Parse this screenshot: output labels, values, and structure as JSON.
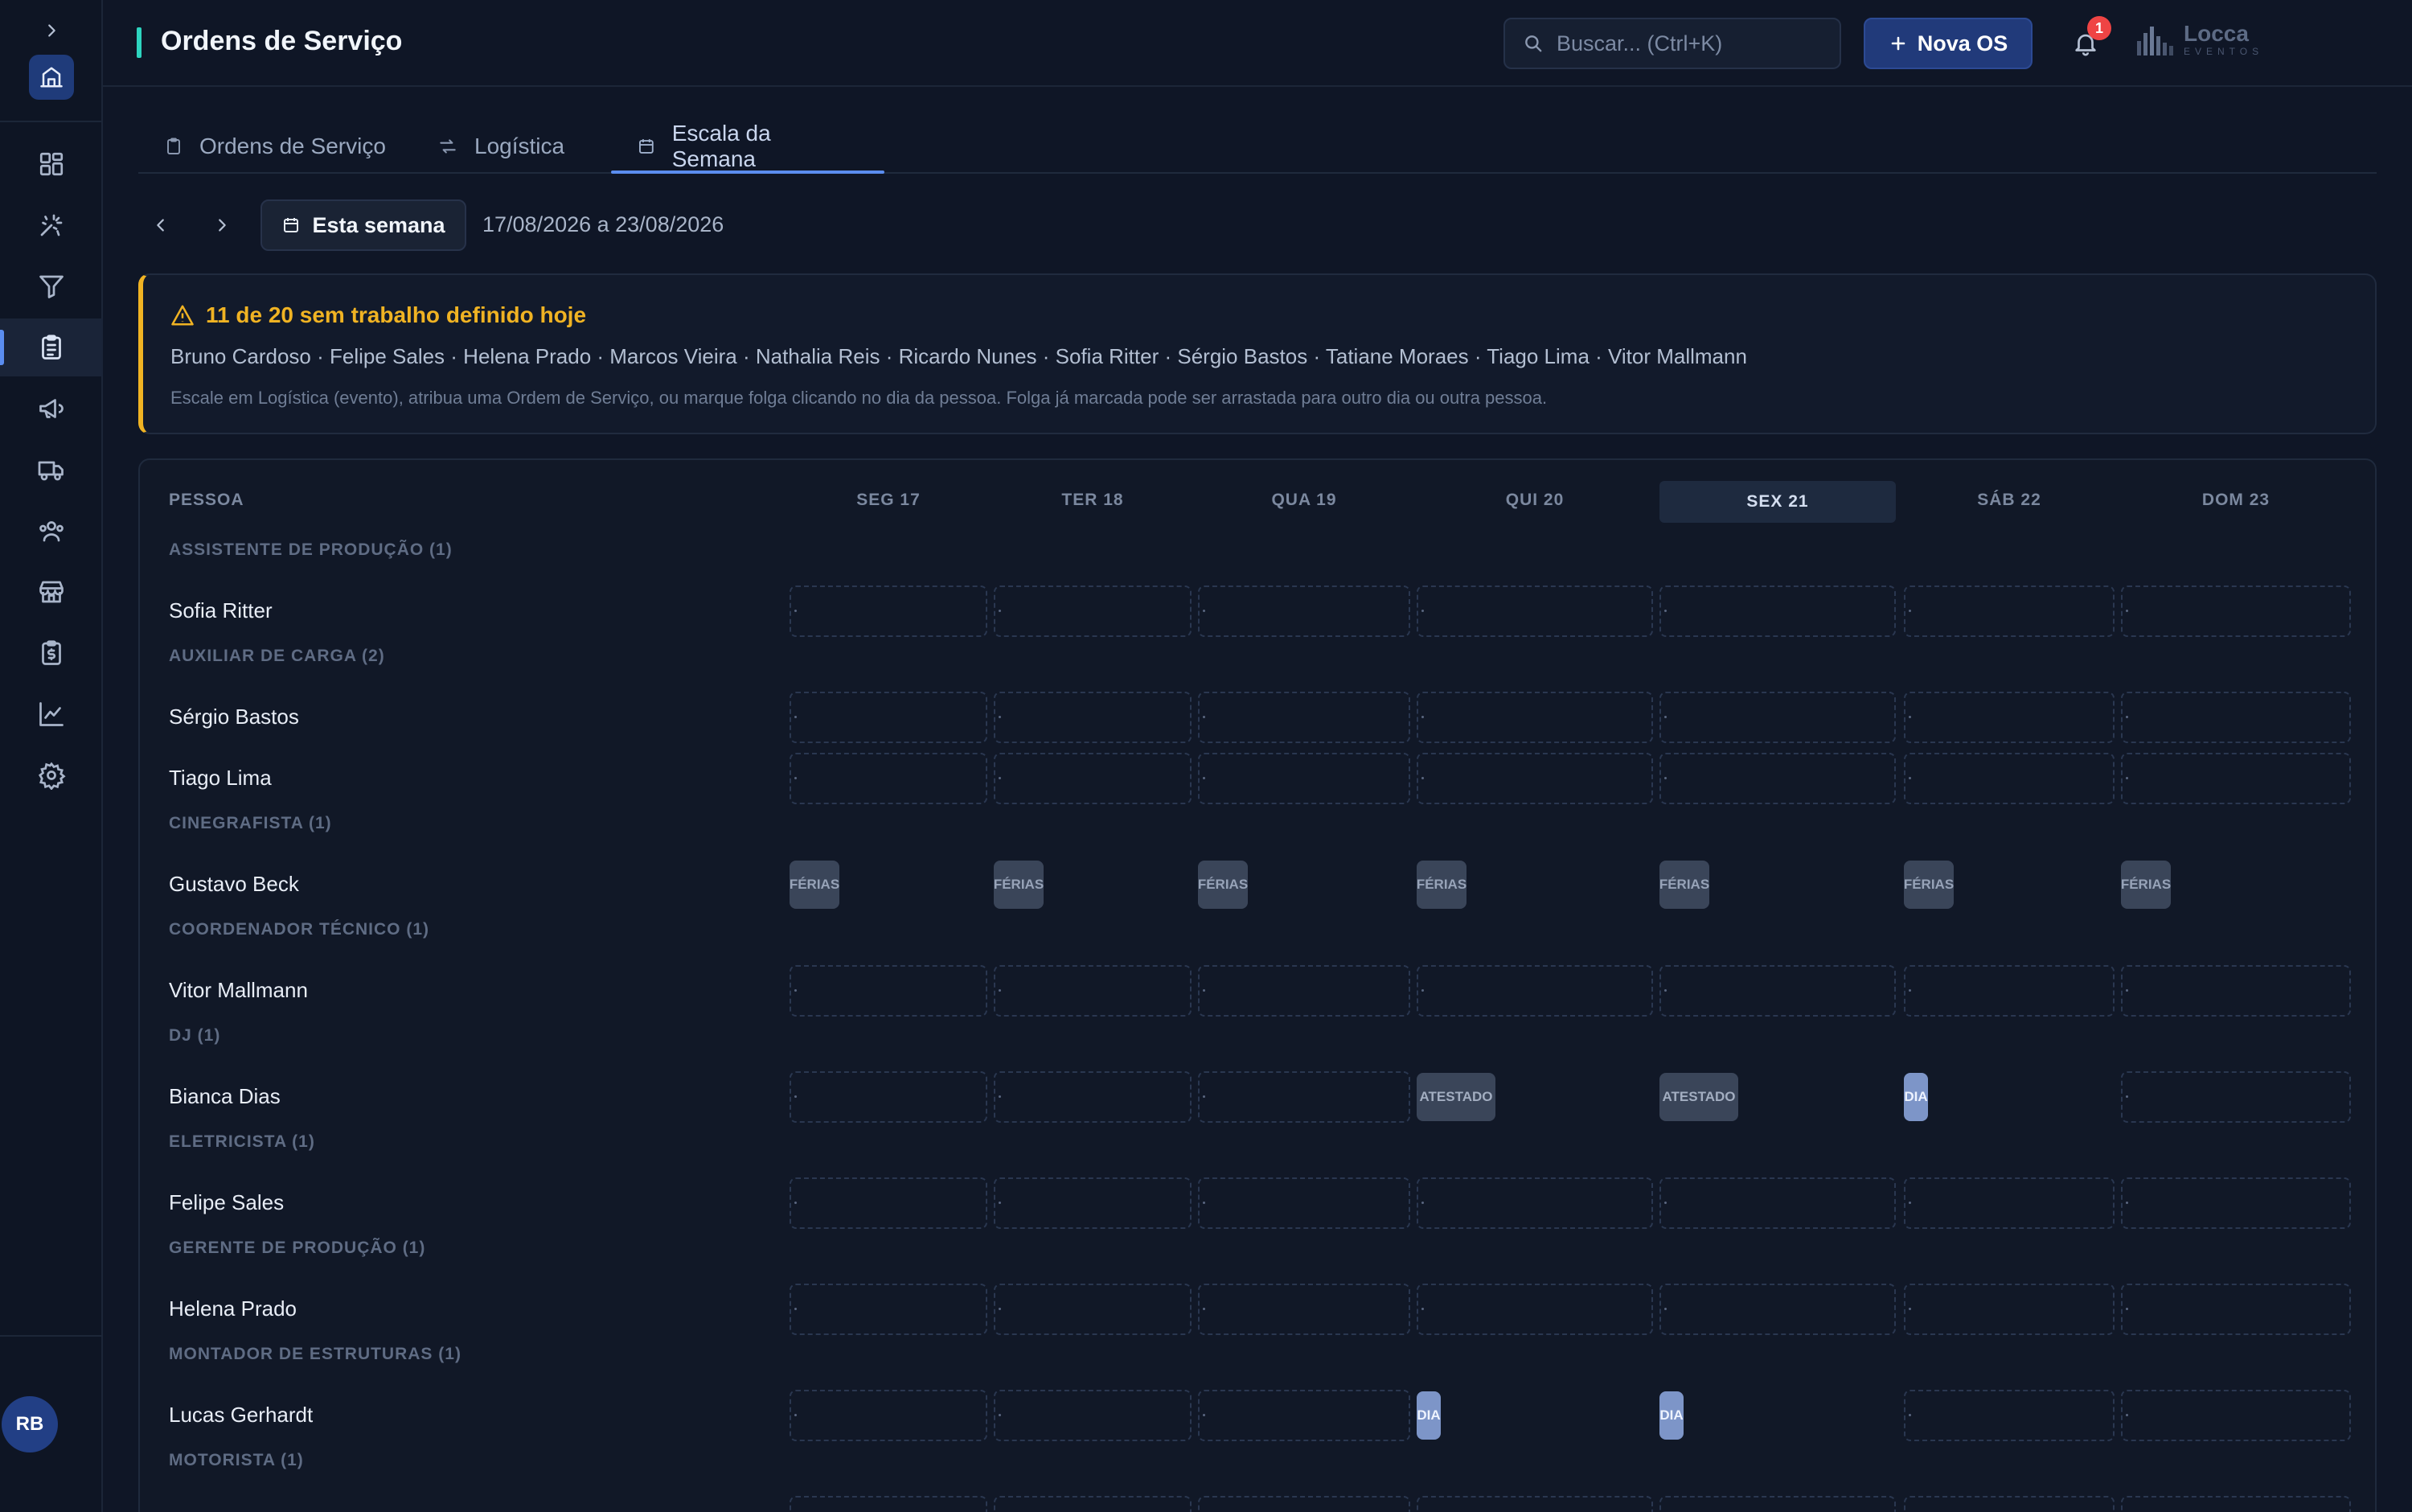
{
  "header": {
    "title": "Ordens de Serviço",
    "search_placeholder": "Buscar... (Ctrl+K)",
    "new_button": "Nova OS",
    "notifications": "1",
    "logo_main": "Locca",
    "logo_sub": "EVENTOS"
  },
  "user": {
    "initials": "RB"
  },
  "sidebar": {
    "items": [
      {
        "icon": "dashboard-icon"
      },
      {
        "icon": "sparkles-icon"
      },
      {
        "icon": "filter-icon"
      },
      {
        "icon": "clipboard-icon",
        "active": true
      },
      {
        "icon": "megaphone-icon"
      },
      {
        "icon": "truck-icon"
      },
      {
        "icon": "users-icon"
      },
      {
        "icon": "store-icon"
      },
      {
        "icon": "money-clipboard-icon"
      },
      {
        "icon": "chart-icon"
      },
      {
        "icon": "gear-icon"
      }
    ]
  },
  "tabs": [
    {
      "label": "Ordens de Serviço",
      "icon": "clipboard-icon"
    },
    {
      "label": "Logística",
      "icon": "route-icon"
    },
    {
      "label": "Escala da Semana",
      "icon": "calendar-icon",
      "active": true
    }
  ],
  "week": {
    "button": "Esta semana",
    "range": "17/08/2026 a 23/08/2026"
  },
  "alert": {
    "title": "11 de 20 sem trabalho definido hoje",
    "names": "Bruno Cardoso · Felipe Sales · Helena Prado · Marcos Vieira · Nathalia Reis · Ricardo Nunes · Sofia Ritter · Sérgio Bastos · Tatiane Moraes · Tiago Lima · Vitor Mallmann",
    "hint": "Escale em Logística (evento), atribua uma Ordem de Serviço, ou marque folga clicando no dia da pessoa. Folga já marcada pode ser arrastada para outro dia ou outra pessoa.",
    "accent": "#f0b323"
  },
  "grid": {
    "person_header": "PESSOA",
    "days": [
      "SEG 17",
      "TER 18",
      "QUA 19",
      "QUI 20",
      "SEX 21",
      "SÁB 22",
      "DOM 23"
    ],
    "today_index": 4,
    "groups": [
      {
        "label": "ASSISTENTE DE PRODUÇÃO (1)",
        "people": [
          {
            "name": "Sofia Ritter",
            "cells": [
              "empty",
              "empty",
              "empty",
              "empty",
              "empty",
              "empty",
              "empty"
            ]
          }
        ]
      },
      {
        "label": "AUXILIAR DE CARGA (2)",
        "people": [
          {
            "name": "Sérgio Bastos",
            "cells": [
              "empty",
              "empty",
              "empty",
              "empty",
              "empty",
              "empty",
              "empty"
            ]
          },
          {
            "name": "Tiago Lima",
            "cells": [
              "empty",
              "empty",
              "empty",
              "empty",
              "empty",
              "empty",
              "empty"
            ]
          }
        ]
      },
      {
        "label": "CINEGRAFISTA (1)",
        "people": [
          {
            "name": "Gustavo Beck",
            "cells": [
              "FÉRIAS",
              "FÉRIAS",
              "FÉRIAS",
              "FÉRIAS",
              "FÉRIAS",
              "FÉRIAS",
              "FÉRIAS"
            ]
          }
        ]
      },
      {
        "label": "COORDENADOR TÉCNICO (1)",
        "people": [
          {
            "name": "Vitor Mallmann",
            "cells": [
              "empty",
              "empty",
              "empty",
              "empty",
              "empty",
              "empty",
              "empty"
            ]
          }
        ]
      },
      {
        "label": "DJ (1)",
        "people": [
          {
            "name": "Bianca Dias",
            "cells": [
              "empty",
              "empty",
              "empty",
              "ATESTADO",
              "ATESTADO",
              "DIA",
              "empty"
            ]
          }
        ]
      },
      {
        "label": "ELETRICISTA (1)",
        "people": [
          {
            "name": "Felipe Sales",
            "cells": [
              "empty",
              "empty",
              "empty",
              "empty",
              "empty",
              "empty",
              "empty"
            ]
          }
        ]
      },
      {
        "label": "GERENTE DE PRODUÇÃO (1)",
        "people": [
          {
            "name": "Helena Prado",
            "cells": [
              "empty",
              "empty",
              "empty",
              "empty",
              "empty",
              "empty",
              "empty"
            ]
          }
        ]
      },
      {
        "label": "MONTADOR DE ESTRUTURAS (1)",
        "people": [
          {
            "name": "Lucas Gerhardt",
            "cells": [
              "empty",
              "empty",
              "empty",
              "DIA",
              "DIA",
              "empty",
              "empty"
            ]
          }
        ]
      },
      {
        "label": "MOTORISTA (1)",
        "people": [
          {
            "name": "",
            "cells": [
              "empty",
              "empty",
              "empty",
              "empty",
              "empty",
              "empty",
              "empty"
            ]
          }
        ]
      }
    ]
  }
}
